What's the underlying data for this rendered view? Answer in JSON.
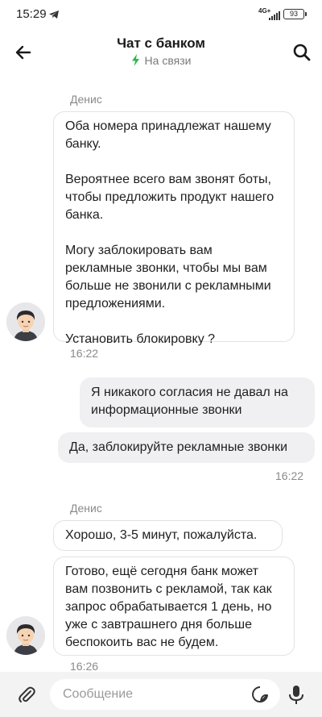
{
  "status_bar": {
    "time": "15:29",
    "network": "4G+",
    "battery": "93"
  },
  "header": {
    "title": "Чат с банком",
    "status": "На связи"
  },
  "messages": {
    "group1": {
      "sender": "Денис",
      "text": "Оба номера принадлежат нашему банку.\n\nВероятнее всего вам звонят боты, чтобы предложить продукт нашего банка.\n\nМогу заблокировать вам рекламные звонки, чтобы мы вам больше не звонили с рекламными предложениями.\n\nУстановить блокировку ?",
      "time": "16:22"
    },
    "outgoing1": {
      "text": "Я никакого согласия не давал на информационные звонки"
    },
    "outgoing2": {
      "text": "Да, заблокируйте рекламные звонки",
      "time": "16:22"
    },
    "group2": {
      "sender": "Денис",
      "text1": "Хорошо, 3-5 минут, пожалуйста.",
      "text2": "Готово, ещё сегодня банк может вам позвонить с рекламой, так как запрос обрабатывается 1 день, но уже с завтрашнего дня больше беспокоить вас не будем.",
      "time": "16:26"
    }
  },
  "composer": {
    "placeholder": "Сообщение"
  },
  "colors": {
    "online": "#2fb84a",
    "accent": "#1f1f1f"
  },
  "icons": [
    "telegram-icon",
    "signal-icon",
    "back-arrow-icon",
    "search-icon",
    "lightning-icon",
    "avatar-icon",
    "paperclip-icon",
    "sticker-icon",
    "microphone-icon"
  ]
}
